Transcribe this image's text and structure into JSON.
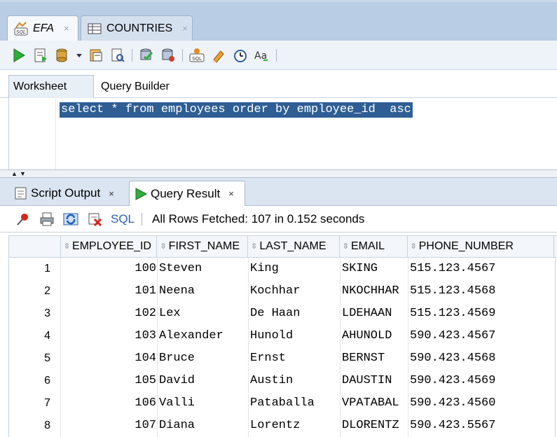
{
  "editor_tabs": [
    {
      "label": "EFA",
      "close": "×"
    },
    {
      "label": "COUNTRIES",
      "close": "×"
    }
  ],
  "worksheet_tabs": [
    "Worksheet",
    "Query Builder"
  ],
  "editor": {
    "sql": "select * from employees order by employee_id  asc"
  },
  "result_tabs": [
    {
      "label": "Script Output",
      "close": "×"
    },
    {
      "label": "Query Result",
      "close": "×"
    }
  ],
  "result_toolbar": {
    "sql_link": "SQL",
    "status": "All Rows Fetched: 107 in 0.152 seconds"
  },
  "grid": {
    "columns": [
      "EMPLOYEE_ID",
      "FIRST_NAME",
      "LAST_NAME",
      "EMAIL",
      "PHONE_NUMBER"
    ],
    "rows": [
      {
        "n": "1",
        "id": "100",
        "first": "Steven",
        "last": "King",
        "email": "SKING",
        "phone": "515.123.4567"
      },
      {
        "n": "2",
        "id": "101",
        "first": "Neena",
        "last": "Kochhar",
        "email": "NKOCHHAR",
        "phone": "515.123.4568"
      },
      {
        "n": "3",
        "id": "102",
        "first": "Lex",
        "last": "De Haan",
        "email": "LDEHAAN",
        "phone": "515.123.4569"
      },
      {
        "n": "4",
        "id": "103",
        "first": "Alexander",
        "last": "Hunold",
        "email": "AHUNOLD",
        "phone": "590.423.4567"
      },
      {
        "n": "5",
        "id": "104",
        "first": "Bruce",
        "last": "Ernst",
        "email": "BERNST",
        "phone": "590.423.4568"
      },
      {
        "n": "6",
        "id": "105",
        "first": "David",
        "last": "Austin",
        "email": "DAUSTIN",
        "phone": "590.423.4569"
      },
      {
        "n": "7",
        "id": "106",
        "first": "Valli",
        "last": "Pataballa",
        "email": "VPATABAL",
        "phone": "590.423.4560"
      },
      {
        "n": "8",
        "id": "107",
        "first": "Diana",
        "last": "Lorentz",
        "email": "DLORENTZ",
        "phone": "590.423.5567"
      }
    ]
  },
  "icons": {
    "toolbar": [
      "run-statement-icon",
      "run-script-icon",
      "commit-icon",
      "dropdown-arrow-icon",
      "rollback-icon",
      "explain-plan-icon",
      "autotrace-icon",
      "sql-tuning-icon",
      "unshared-sql-icon",
      "clear-icon",
      "history-icon",
      "format-icon"
    ],
    "result_toolbar": [
      "pin-icon",
      "print-icon",
      "refresh-icon",
      "clear-results-icon"
    ]
  },
  "colors": {
    "selection": "#2e5e94",
    "tab_strip": "#b9cde5",
    "sql_link": "#2c5fb0"
  }
}
